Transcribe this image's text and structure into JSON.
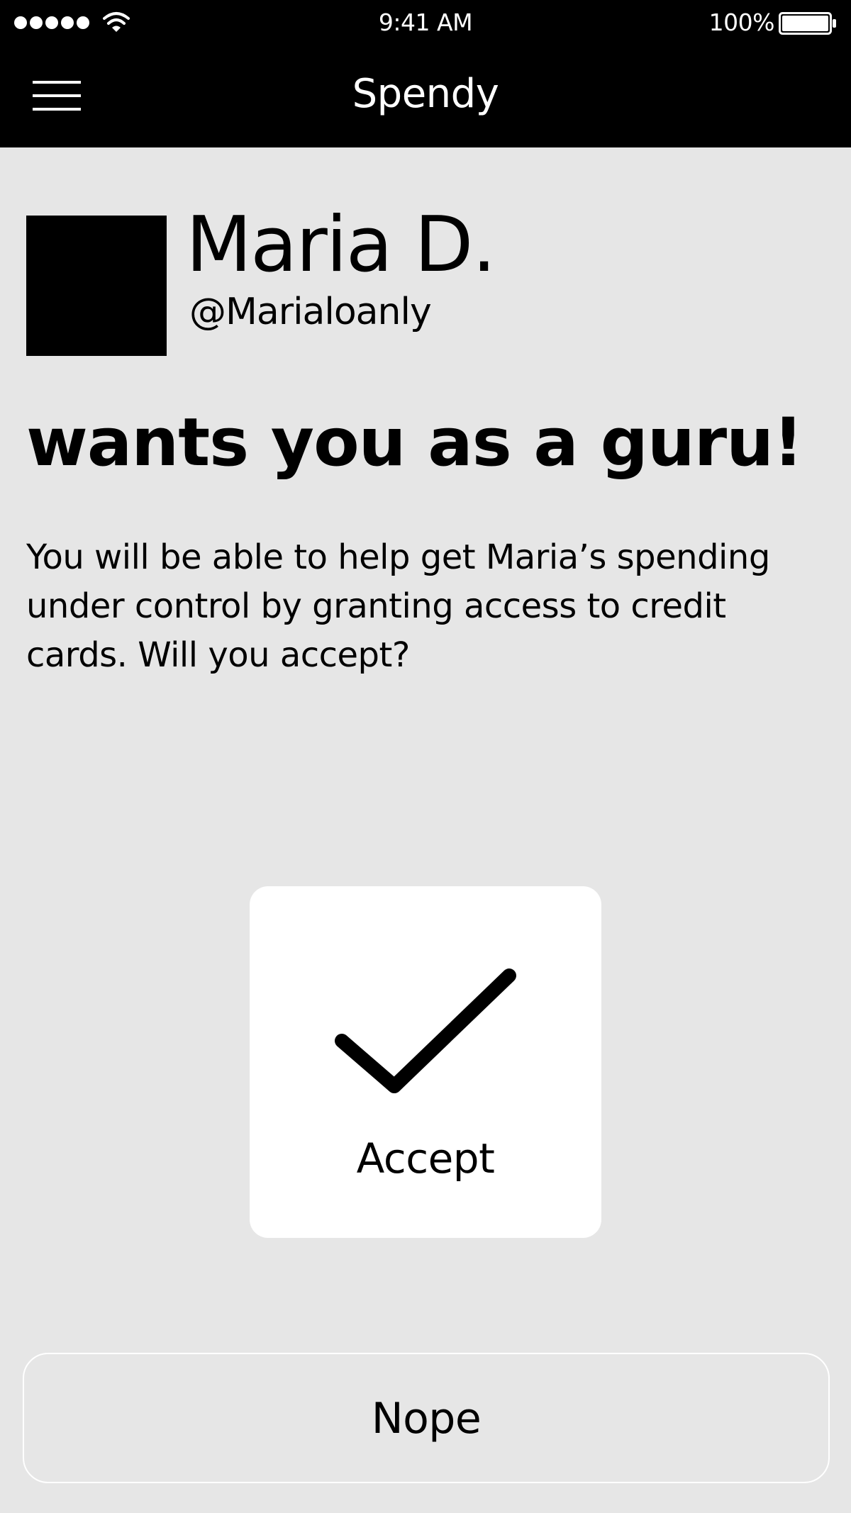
{
  "status_bar": {
    "time": "9:41 AM",
    "battery_text": "100%",
    "battery_level": 1.0,
    "signal_bars": 5,
    "icons": [
      "signal-dots-icon",
      "wifi-icon",
      "battery-icon"
    ]
  },
  "nav": {
    "title": "Spendy",
    "menu_icon": "hamburger-menu-icon"
  },
  "profile": {
    "name": "Maria D.",
    "handle": "@Marialoanly"
  },
  "message": {
    "headline": "wants you as a guru!",
    "body": "You will be able to help get Maria’s spending under control by granting access to credit cards. Will you accept?"
  },
  "actions": {
    "accept_label": "Accept",
    "accept_icon": "checkmark-icon",
    "nope_label": "Nope"
  },
  "colors": {
    "bar_background": "#000000",
    "page_background": "#e6e6e6",
    "card_background": "#ffffff",
    "text": "#000000"
  }
}
